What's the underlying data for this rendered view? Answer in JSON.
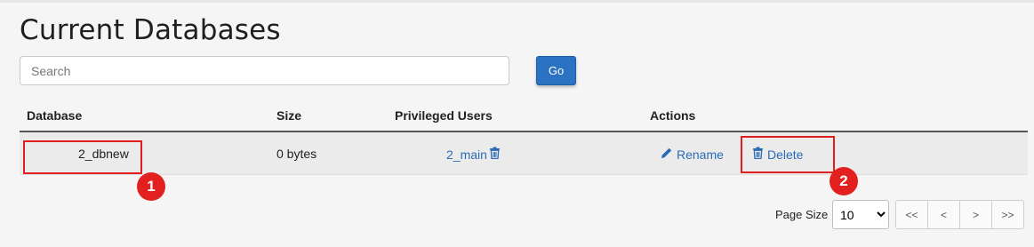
{
  "page": {
    "title": "Current Databases"
  },
  "search": {
    "placeholder": "Search",
    "value": "",
    "go_label": "Go"
  },
  "table": {
    "columns": [
      "Database",
      "Size",
      "Privileged Users",
      "Actions"
    ],
    "rows": [
      {
        "database": "2_dbnew",
        "size": "0 bytes",
        "user": "2_main",
        "actions": {
          "rename": "Rename",
          "delete": "Delete"
        }
      }
    ]
  },
  "annotations": {
    "badge1": "1",
    "badge2": "2",
    "highlight_color": "#e02020"
  },
  "pagination": {
    "page_size_label": "Page Size",
    "page_size_value": "10",
    "buttons": [
      "<<",
      "<",
      ">",
      ">>"
    ]
  },
  "colors": {
    "accent": "#2b72c3",
    "link": "#2b6cb7",
    "row_bg": "#ebebeb"
  },
  "icons": {
    "user_remove": "trash-icon",
    "rename": "pencil-icon",
    "delete": "trash-icon"
  }
}
